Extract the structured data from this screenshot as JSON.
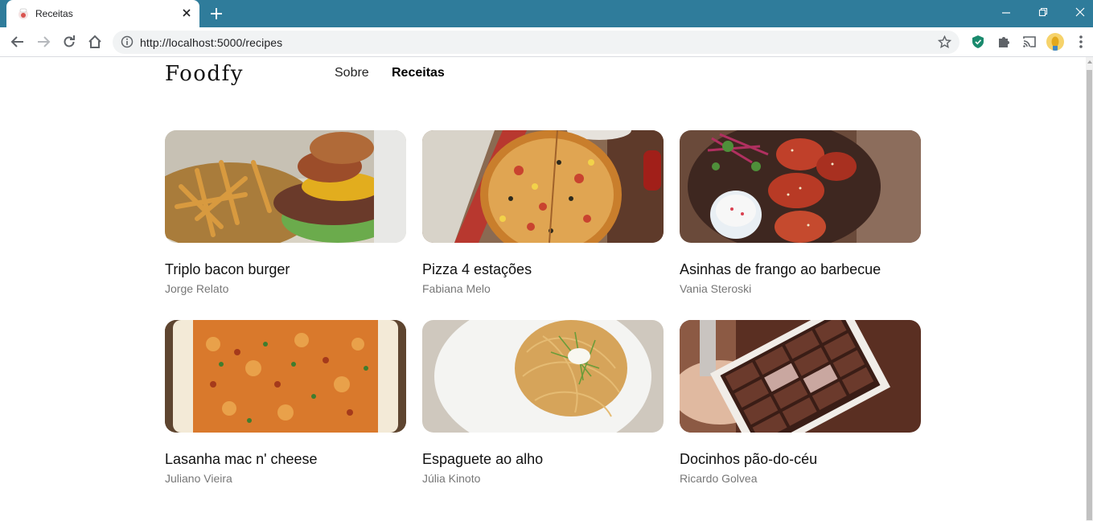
{
  "browser": {
    "tab_title": "Receitas",
    "url": "http://localhost:5000/recipes",
    "frame_color": "#2f7c9b"
  },
  "site": {
    "logo": "Foodfy",
    "nav": [
      {
        "label": "Sobre",
        "active": false
      },
      {
        "label": "Receitas",
        "active": true
      }
    ]
  },
  "recipes": [
    {
      "title": "Triplo bacon burger",
      "author": "Jorge Relato",
      "image": "burger-with-fries"
    },
    {
      "title": "Pizza 4 estações",
      "author": "Fabiana Melo",
      "image": "pizza"
    },
    {
      "title": "Asinhas de frango ao barbecue",
      "author": "Vania Steroski",
      "image": "bbq-chicken-wings"
    },
    {
      "title": "Lasanha mac n' cheese",
      "author": "Juliano Vieira",
      "image": "mac-and-cheese-lasagna"
    },
    {
      "title": "Espaguete ao alho",
      "author": "Júlia Kinoto",
      "image": "garlic-spaghetti"
    },
    {
      "title": "Docinhos pão-do-céu",
      "author": "Ricardo Golvea",
      "image": "chocolate-box"
    }
  ]
}
